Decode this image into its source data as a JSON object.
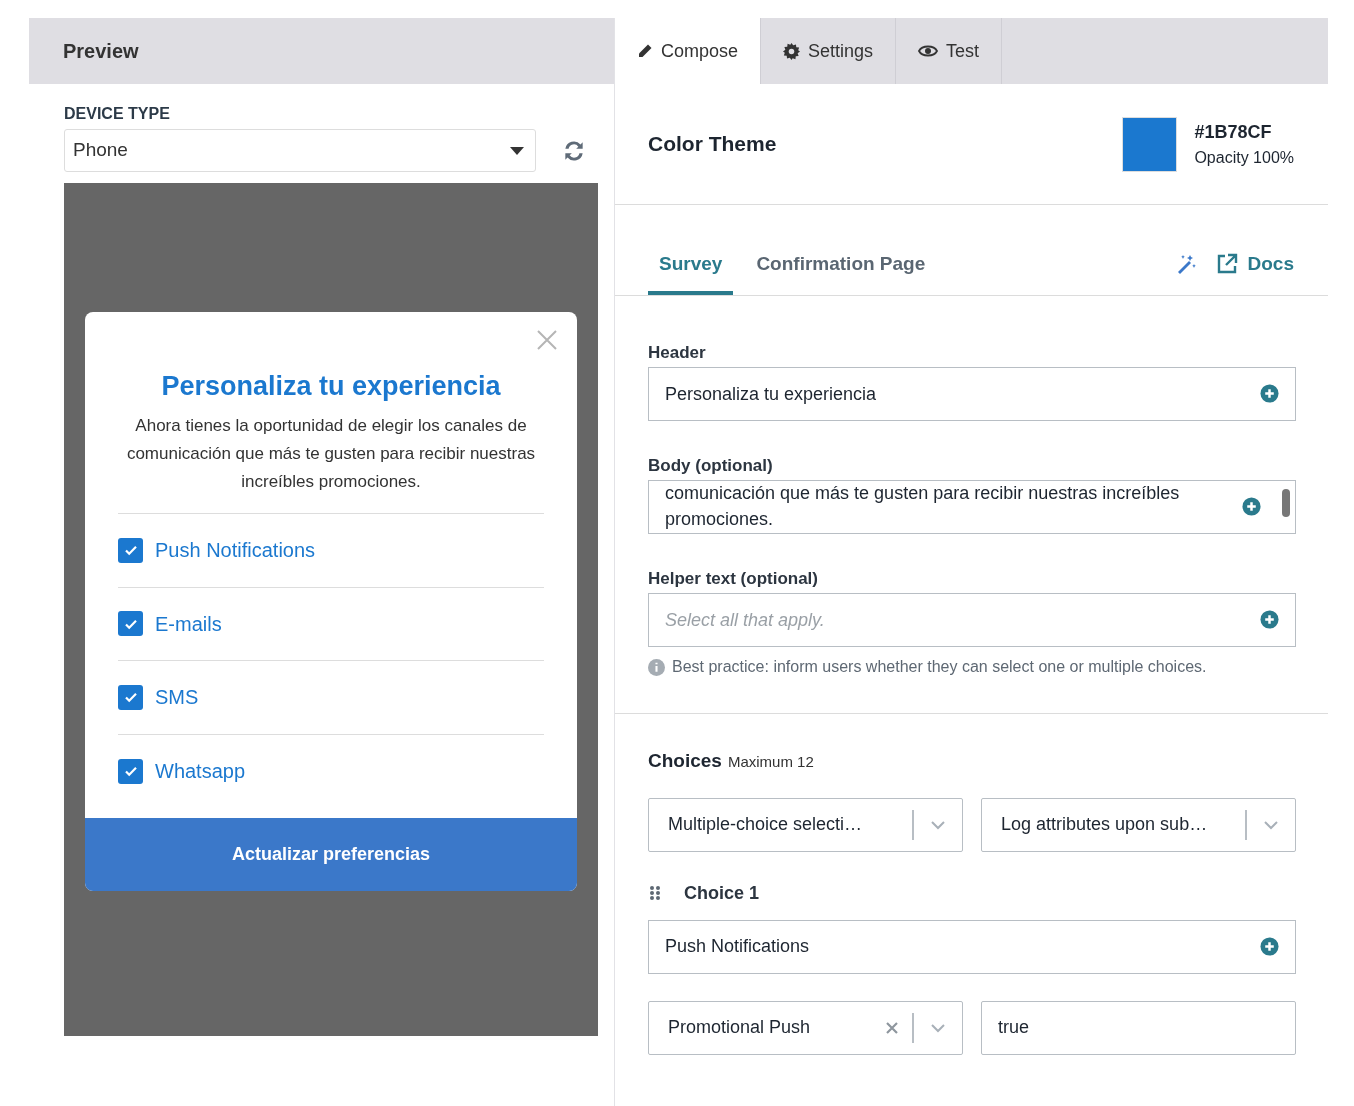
{
  "preview": {
    "title": "Preview",
    "device_type": {
      "label": "DEVICE TYPE",
      "value": "Phone"
    },
    "modal": {
      "title": "Personaliza tu experiencia",
      "body": "Ahora tienes la oportunidad de elegir los canales de comunicación que más te gusten para recibir nuestras increíbles promociones.",
      "options": [
        {
          "label": "Push Notifications",
          "checked": true
        },
        {
          "label": "E-mails",
          "checked": true
        },
        {
          "label": "SMS",
          "checked": true
        },
        {
          "label": "Whatsapp",
          "checked": true
        }
      ],
      "button": "Actualizar preferencias"
    }
  },
  "tabs": [
    {
      "label": "Compose",
      "kind": "pencil",
      "selected": true
    },
    {
      "label": "Settings",
      "kind": "gear",
      "selected": false
    },
    {
      "label": "Test",
      "kind": "eye",
      "selected": false
    }
  ],
  "color_theme": {
    "label": "Color Theme",
    "color": "#1b78cf",
    "hex": "#1B78CF",
    "opacity": "Opacity 100%"
  },
  "subtabs": [
    {
      "label": "Survey",
      "selected": true
    },
    {
      "label": "Confirmation Page",
      "selected": false
    }
  ],
  "docs_link": "Docs",
  "fields": [
    {
      "label": "Header",
      "value": "Personaliza tu experiencia"
    },
    {
      "label": "Body (optional)",
      "value": "comunicación que más te gusten para recibir nuestras increíbles promociones."
    },
    {
      "label": "Helper text (optional)",
      "placeholder": "Select all that apply."
    }
  ],
  "helper_note": "Best practice: inform users whether they can select one or multiple choices.",
  "choices": {
    "label": "Choices",
    "max": "Maximum 12",
    "selects": [
      "Multiple-choice selecti…",
      "Log attributes upon sub…"
    ],
    "items": [
      {
        "label": "Choice 1",
        "value": "Push Notifications",
        "attribute": "Promotional Push",
        "attribute_value": "true"
      }
    ]
  }
}
